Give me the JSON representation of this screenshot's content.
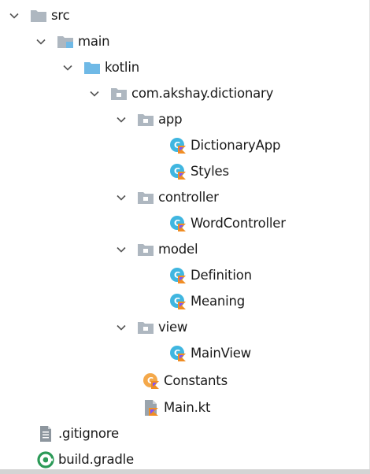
{
  "project_tree": {
    "src": {
      "label": "src",
      "icon": "folder-icon"
    },
    "main": {
      "label": "main",
      "icon": "source-root-folder-icon"
    },
    "kotlin": {
      "label": "kotlin",
      "icon": "blue-source-folder-icon"
    },
    "package": {
      "label": "com.akshay.dictionary",
      "icon": "package-icon"
    },
    "app": {
      "label": "app",
      "icon": "package-icon"
    },
    "dictionary_app": {
      "label": "DictionaryApp",
      "icon": "kotlin-class-icon"
    },
    "styles": {
      "label": "Styles",
      "icon": "kotlin-class-icon"
    },
    "controller": {
      "label": "controller",
      "icon": "package-icon"
    },
    "word_controller": {
      "label": "WordController",
      "icon": "kotlin-class-icon"
    },
    "model": {
      "label": "model",
      "icon": "package-icon"
    },
    "definition": {
      "label": "Definition",
      "icon": "kotlin-class-icon"
    },
    "meaning": {
      "label": "Meaning",
      "icon": "kotlin-class-icon"
    },
    "view": {
      "label": "view",
      "icon": "package-icon"
    },
    "main_view": {
      "label": "MainView",
      "icon": "kotlin-class-icon"
    },
    "constants": {
      "label": "Constants",
      "icon": "kotlin-object-icon"
    },
    "main_kt": {
      "label": "Main.kt",
      "icon": "kotlin-file-icon"
    },
    "gitignore": {
      "label": ".gitignore",
      "icon": "text-file-icon"
    },
    "build_gradle": {
      "label": "build.gradle",
      "icon": "gradle-icon"
    }
  },
  "colors": {
    "folder": "#aeb7c0",
    "source_folder": "#6fb9e6",
    "class_circle": "#40b6e0",
    "object_circle": "#f4a84a",
    "kotlin_mark": "#f08d24",
    "gradle": "#2b9a57",
    "chevron": "#555555"
  }
}
